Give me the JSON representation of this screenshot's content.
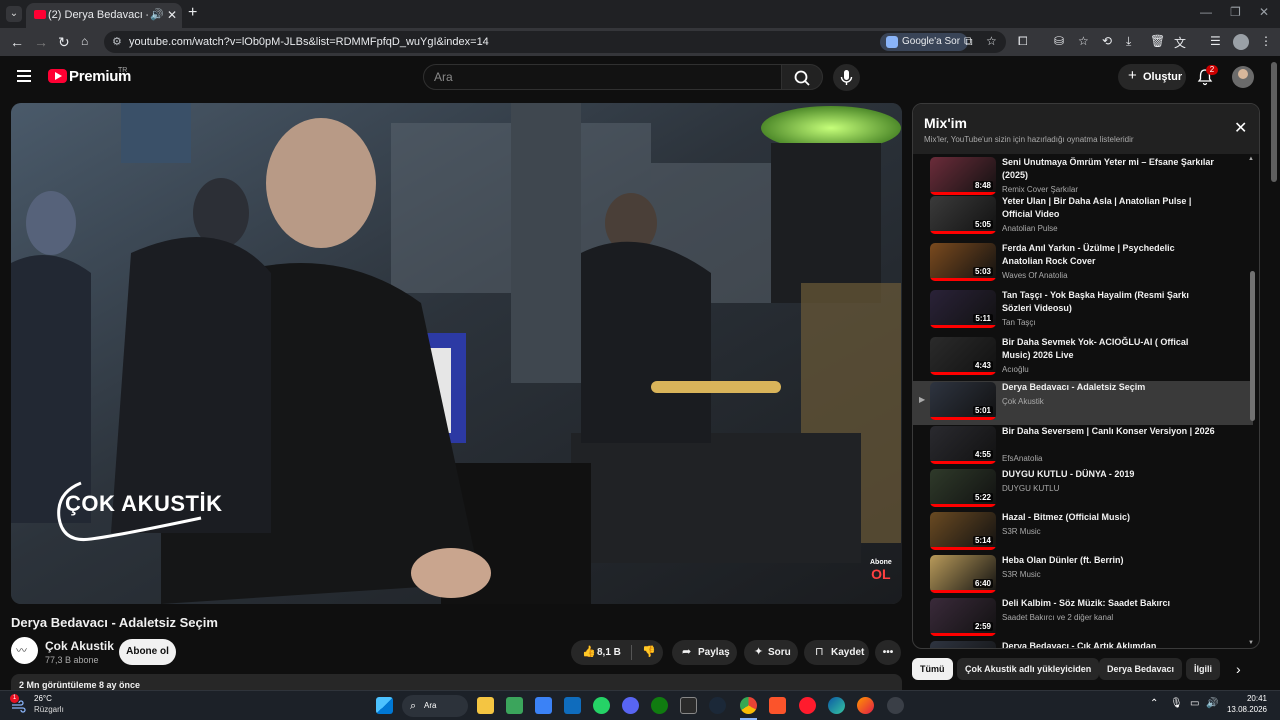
{
  "browser": {
    "tab_title": "(2) Derya Bedavacı - Adalet",
    "url": "youtube.com/watch?v=lOb0pM-JLBs&list=RDMMFpfqD_wuYgI&index=14",
    "ask_google": "Google'a Sor"
  },
  "youtube": {
    "logo_text": "Premium",
    "country": "TR",
    "search_placeholder": "Ara",
    "create_label": "Oluştur",
    "notif_count": "2"
  },
  "video": {
    "title": "Derya Bedavacı - Adaletsiz Seçim",
    "channel": "Çok Akustik",
    "subscribers": "77,3 B abone",
    "subscribe_label": "Abone ol",
    "likes": "8,1 B",
    "share_label": "Paylaş",
    "ask_label": "Soru",
    "save_label": "Kaydet",
    "views_partial": "2 Mn görüntüleme  8 ay önce",
    "watermark": "ÇOK AKUSTİK",
    "corner_badge_top": "Abone",
    "corner_badge_bottom": "OL"
  },
  "playlist": {
    "title": "Mix'im",
    "subtitle": "Mix'ler, YouTube'un sizin için hazırladığı oynatma listeleridir",
    "items": [
      {
        "title": "Seni Unutmaya Ömrüm Yeter mi – Efsane Şarkılar (2025)",
        "channel": "Remix Cover Şarkılar",
        "duration": "8:48",
        "color": "#6b2c3a"
      },
      {
        "title": "Yeter Ulan | Bir Daha Asla | Anatolian Pulse | Official Video",
        "channel": "Anatolian Pulse",
        "duration": "5:05",
        "color": "#3b3b3b"
      },
      {
        "title": "Ferda Anıl Yarkın - Üzülme | Psychedelic Anatolian Rock Cover",
        "channel": "Waves Of Anatolia",
        "duration": "5:03",
        "color": "#7a4a1e"
      },
      {
        "title": "Tan Taşçı - Yok Başka Hayalim (Resmi Şarkı Sözleri Videosu)",
        "channel": "Tan Taşçı",
        "duration": "5:11",
        "color": "#2a2238"
      },
      {
        "title": "Bir Daha Sevmek Yok- ACIOĞLU-AI ( Offical Music) 2026 Live",
        "channel": "Acıoğlu",
        "duration": "4:43",
        "color": "#2b2b2b"
      },
      {
        "title": "Derya Bedavacı - Adaletsiz Seçim",
        "channel": "Çok Akustik",
        "duration": "5:01",
        "color": "#2e3440"
      },
      {
        "title": "Bir Daha Seversem | Canlı Konser Versiyon | 2026",
        "channel": "EfsAnatolia",
        "duration": "4:55",
        "color": "#2a2a2f"
      },
      {
        "title": "DUYGU KUTLU - DÜNYA - 2019",
        "channel": "DUYGU KUTLU",
        "duration": "5:22",
        "color": "#2f3a2a"
      },
      {
        "title": "Hazal - Bitmez (Official Music)",
        "channel": "S3R Music",
        "duration": "5:14",
        "color": "#6a4a22"
      },
      {
        "title": "Heba Olan Dünler (ft. Berrin)",
        "channel": "S3R Music",
        "duration": "6:40",
        "color": "#b89a5a"
      },
      {
        "title": "Deli Kalbim - Söz Müzik: Saadet Bakırcı",
        "channel": "Saadet Bakırcı ve 2 diğer kanal",
        "duration": "2:59",
        "color": "#3a2a3a"
      },
      {
        "title": "Derya Bedavacı - Çık Artık Aklımdan",
        "channel": "",
        "duration": "",
        "color": "#2e3440"
      }
    ]
  },
  "chips": [
    "Tümü",
    "Çok Akustik adlı yükleyiciden",
    "Derya Bedavacı",
    "İlgili"
  ],
  "taskbar": {
    "weather_badge": "1",
    "temperature": "26°C",
    "weather": "Rüzgarlı",
    "search_label": "Ara",
    "time": "20:41",
    "date": "13.08.2026"
  }
}
